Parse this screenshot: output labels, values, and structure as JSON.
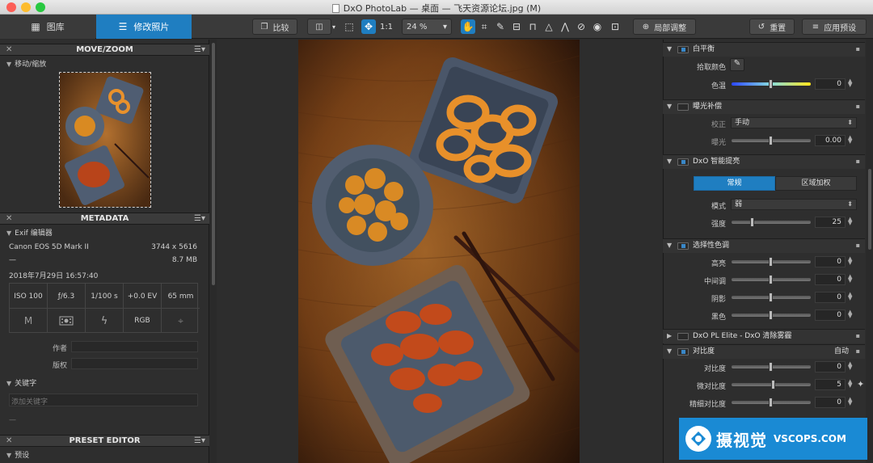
{
  "window": {
    "title": "DxO PhotoLab — 桌面 — 飞天资源论坛.jpg (M)"
  },
  "toolbar": {
    "tabs": [
      {
        "label": "图库"
      },
      {
        "label": "修改照片"
      }
    ],
    "compare_label": "比较",
    "zoom_11_label": "1:1",
    "zoom_value": "24 %",
    "local_adjust_label": "局部调整",
    "reset_label": "重置",
    "apply_preset_label": "应用预设"
  },
  "left": {
    "move_zoom": {
      "title": "MOVE/ZOOM",
      "sub": "移动/缩放"
    },
    "metadata": {
      "title": "METADATA",
      "exif_sub": "Exif 编辑器",
      "camera": "Canon EOS 5D Mark II",
      "dimensions": "3744 x 5616",
      "lens": "—",
      "filesize": "8.7 MB",
      "datetime": "2018年7月29日 16:57:40",
      "iso": "ISO 100",
      "aperture": "ƒ/6.3",
      "shutter": "1/100 s",
      "ev": "+0.0 EV",
      "focal": "65 mm",
      "mode": "M",
      "colorspace": "RGB",
      "author_label": "作者",
      "copyright_label": "版权",
      "keywords_sub": "关键字",
      "keywords_placeholder": "添加关键字",
      "keywords_dash": "—"
    },
    "preset_editor": {
      "title": "PRESET EDITOR",
      "sub": "预设"
    }
  },
  "right": {
    "white_balance": {
      "title": "白平衡",
      "picker_label": "拾取颜色",
      "temp_label": "色温",
      "temp_value": "0"
    },
    "exposure": {
      "title": "曝光补偿",
      "mode_label": "校正",
      "mode_value": "手动",
      "exposure_label": "曝光",
      "exposure_value": "0.00"
    },
    "smart_lighting": {
      "title": "DxO 智能提亮",
      "seg_on": "常规",
      "seg_off": "区域加权",
      "mode_label": "模式",
      "mode_value": "弱",
      "strength_label": "强度",
      "strength_value": "25"
    },
    "selective_tone": {
      "title": "选择性色调",
      "highlights_label": "高亮",
      "highlights_value": "0",
      "midtones_label": "中间调",
      "midtones_value": "0",
      "shadows_label": "阴影",
      "shadows_value": "0",
      "blacks_label": "黑色",
      "blacks_value": "0"
    },
    "clearview": {
      "title": "DxO PL Elite - DxO 清除雾霾"
    },
    "contrast": {
      "title": "对比度",
      "auto_label": "自动",
      "contrast_label": "对比度",
      "contrast_value": "0",
      "micro_label": "微对比度",
      "micro_value": "5",
      "fine_label": "精细对比度",
      "fine_value": "0"
    }
  },
  "watermark": {
    "cn": "摄视觉",
    "en": "VSCOPS.COM"
  }
}
